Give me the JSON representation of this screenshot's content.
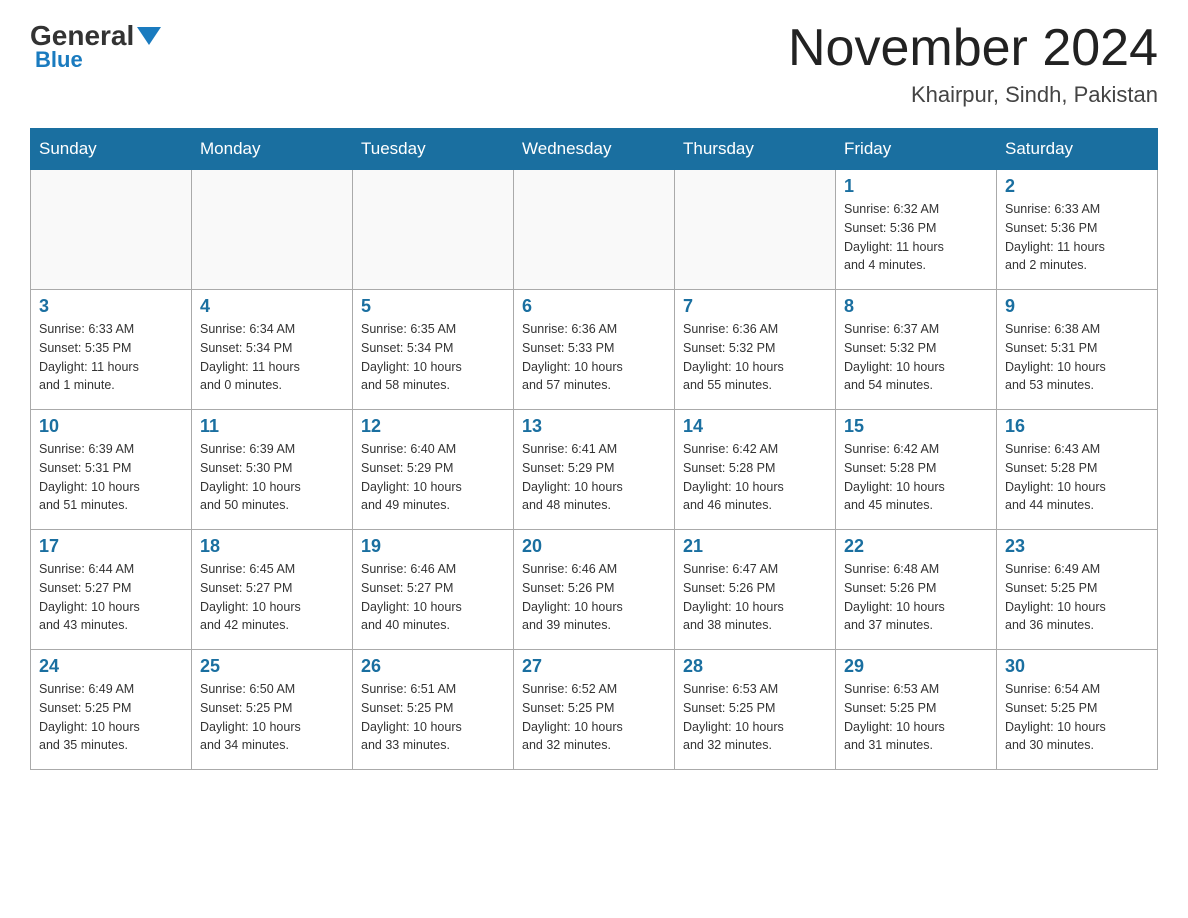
{
  "header": {
    "logo_general": "General",
    "logo_blue": "Blue",
    "month_year": "November 2024",
    "location": "Khairpur, Sindh, Pakistan"
  },
  "days_of_week": [
    "Sunday",
    "Monday",
    "Tuesday",
    "Wednesday",
    "Thursday",
    "Friday",
    "Saturday"
  ],
  "weeks": [
    [
      {
        "day": "",
        "info": ""
      },
      {
        "day": "",
        "info": ""
      },
      {
        "day": "",
        "info": ""
      },
      {
        "day": "",
        "info": ""
      },
      {
        "day": "",
        "info": ""
      },
      {
        "day": "1",
        "info": "Sunrise: 6:32 AM\nSunset: 5:36 PM\nDaylight: 11 hours\nand 4 minutes."
      },
      {
        "day": "2",
        "info": "Sunrise: 6:33 AM\nSunset: 5:36 PM\nDaylight: 11 hours\nand 2 minutes."
      }
    ],
    [
      {
        "day": "3",
        "info": "Sunrise: 6:33 AM\nSunset: 5:35 PM\nDaylight: 11 hours\nand 1 minute."
      },
      {
        "day": "4",
        "info": "Sunrise: 6:34 AM\nSunset: 5:34 PM\nDaylight: 11 hours\nand 0 minutes."
      },
      {
        "day": "5",
        "info": "Sunrise: 6:35 AM\nSunset: 5:34 PM\nDaylight: 10 hours\nand 58 minutes."
      },
      {
        "day": "6",
        "info": "Sunrise: 6:36 AM\nSunset: 5:33 PM\nDaylight: 10 hours\nand 57 minutes."
      },
      {
        "day": "7",
        "info": "Sunrise: 6:36 AM\nSunset: 5:32 PM\nDaylight: 10 hours\nand 55 minutes."
      },
      {
        "day": "8",
        "info": "Sunrise: 6:37 AM\nSunset: 5:32 PM\nDaylight: 10 hours\nand 54 minutes."
      },
      {
        "day": "9",
        "info": "Sunrise: 6:38 AM\nSunset: 5:31 PM\nDaylight: 10 hours\nand 53 minutes."
      }
    ],
    [
      {
        "day": "10",
        "info": "Sunrise: 6:39 AM\nSunset: 5:31 PM\nDaylight: 10 hours\nand 51 minutes."
      },
      {
        "day": "11",
        "info": "Sunrise: 6:39 AM\nSunset: 5:30 PM\nDaylight: 10 hours\nand 50 minutes."
      },
      {
        "day": "12",
        "info": "Sunrise: 6:40 AM\nSunset: 5:29 PM\nDaylight: 10 hours\nand 49 minutes."
      },
      {
        "day": "13",
        "info": "Sunrise: 6:41 AM\nSunset: 5:29 PM\nDaylight: 10 hours\nand 48 minutes."
      },
      {
        "day": "14",
        "info": "Sunrise: 6:42 AM\nSunset: 5:28 PM\nDaylight: 10 hours\nand 46 minutes."
      },
      {
        "day": "15",
        "info": "Sunrise: 6:42 AM\nSunset: 5:28 PM\nDaylight: 10 hours\nand 45 minutes."
      },
      {
        "day": "16",
        "info": "Sunrise: 6:43 AM\nSunset: 5:28 PM\nDaylight: 10 hours\nand 44 minutes."
      }
    ],
    [
      {
        "day": "17",
        "info": "Sunrise: 6:44 AM\nSunset: 5:27 PM\nDaylight: 10 hours\nand 43 minutes."
      },
      {
        "day": "18",
        "info": "Sunrise: 6:45 AM\nSunset: 5:27 PM\nDaylight: 10 hours\nand 42 minutes."
      },
      {
        "day": "19",
        "info": "Sunrise: 6:46 AM\nSunset: 5:27 PM\nDaylight: 10 hours\nand 40 minutes."
      },
      {
        "day": "20",
        "info": "Sunrise: 6:46 AM\nSunset: 5:26 PM\nDaylight: 10 hours\nand 39 minutes."
      },
      {
        "day": "21",
        "info": "Sunrise: 6:47 AM\nSunset: 5:26 PM\nDaylight: 10 hours\nand 38 minutes."
      },
      {
        "day": "22",
        "info": "Sunrise: 6:48 AM\nSunset: 5:26 PM\nDaylight: 10 hours\nand 37 minutes."
      },
      {
        "day": "23",
        "info": "Sunrise: 6:49 AM\nSunset: 5:25 PM\nDaylight: 10 hours\nand 36 minutes."
      }
    ],
    [
      {
        "day": "24",
        "info": "Sunrise: 6:49 AM\nSunset: 5:25 PM\nDaylight: 10 hours\nand 35 minutes."
      },
      {
        "day": "25",
        "info": "Sunrise: 6:50 AM\nSunset: 5:25 PM\nDaylight: 10 hours\nand 34 minutes."
      },
      {
        "day": "26",
        "info": "Sunrise: 6:51 AM\nSunset: 5:25 PM\nDaylight: 10 hours\nand 33 minutes."
      },
      {
        "day": "27",
        "info": "Sunrise: 6:52 AM\nSunset: 5:25 PM\nDaylight: 10 hours\nand 32 minutes."
      },
      {
        "day": "28",
        "info": "Sunrise: 6:53 AM\nSunset: 5:25 PM\nDaylight: 10 hours\nand 32 minutes."
      },
      {
        "day": "29",
        "info": "Sunrise: 6:53 AM\nSunset: 5:25 PM\nDaylight: 10 hours\nand 31 minutes."
      },
      {
        "day": "30",
        "info": "Sunrise: 6:54 AM\nSunset: 5:25 PM\nDaylight: 10 hours\nand 30 minutes."
      }
    ]
  ]
}
